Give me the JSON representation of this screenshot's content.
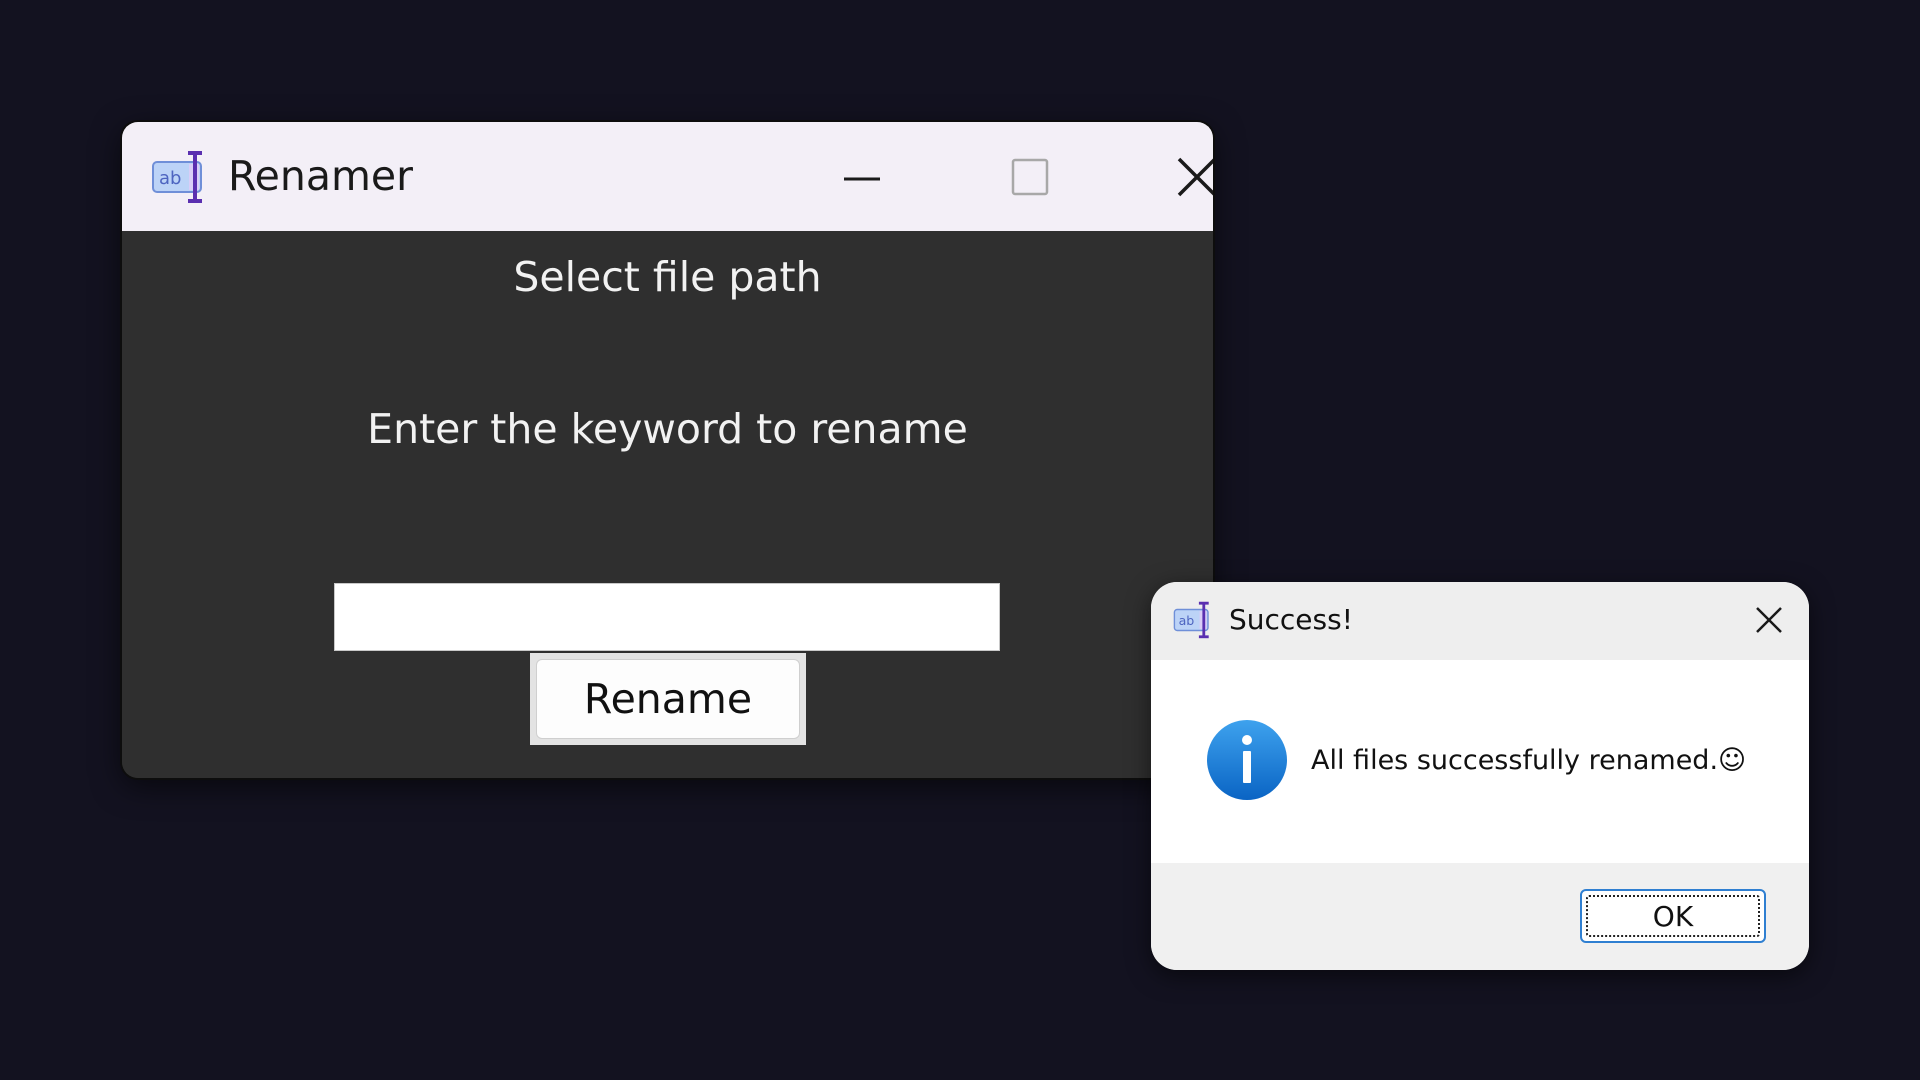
{
  "main_window": {
    "title": "Renamer",
    "icon": "text-field-icon",
    "controls": {
      "minimize": "minimize-icon",
      "maximize": "maximize-icon",
      "close": "close-icon"
    },
    "select_path_label": "Select file path",
    "keyword_label": "Enter the keyword to rename",
    "keyword_input_value": "",
    "rename_button_label": "Rename"
  },
  "dialog": {
    "title": "Success!",
    "icon": "info-icon",
    "message": "All files successfully renamed.☺",
    "ok_label": "OK"
  },
  "colors": {
    "desktop_background": "#131220",
    "window_body": "#2f2f2f",
    "titlebar": "#f3eff7",
    "info_blue": "#1a7fd6",
    "ok_border": "#2f7fd1"
  }
}
